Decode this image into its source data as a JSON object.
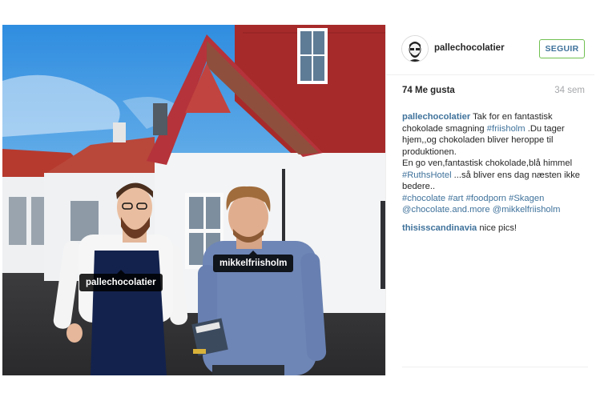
{
  "post": {
    "tags": [
      {
        "label": "pallechocolatier"
      },
      {
        "label": "mikkelfriisholm"
      }
    ]
  },
  "header": {
    "username": "pallechocolatier",
    "follow_label": "SEGUIR"
  },
  "stats": {
    "likes": "74 Me gusta",
    "age": "34 sem"
  },
  "caption": {
    "user": "pallechocolatier",
    "segments": [
      {
        "t": " Tak for en fantastisk chokolade smagning "
      },
      {
        "h": "#friisholm"
      },
      {
        "t": " .Du tager hjem,,og chokoladen bliver heroppe til produktionen."
      },
      {
        "br": true
      },
      {
        "t": "En go ven,fantastisk chokolade,blå himmel "
      },
      {
        "h": "#RuthsHotel"
      },
      {
        "t": " ...så bliver ens dag næsten ikke bedere.."
      },
      {
        "br": true
      },
      {
        "h": "#chocolate"
      },
      {
        "t": " "
      },
      {
        "h": "#art"
      },
      {
        "t": " "
      },
      {
        "h": "#foodporn"
      },
      {
        "t": " "
      },
      {
        "h": "#Skagen"
      },
      {
        "t": " "
      },
      {
        "h": "@chocolate.and.more"
      },
      {
        "t": " "
      },
      {
        "h": "@mikkelfriisholm"
      }
    ]
  },
  "comments": [
    {
      "user": "thisisscandinavia",
      "text": " nice pics!"
    }
  ],
  "colors": {
    "link": "#3f729b",
    "follow_border": "#70c050",
    "muted": "#a5a7aa",
    "text": "#262626"
  }
}
